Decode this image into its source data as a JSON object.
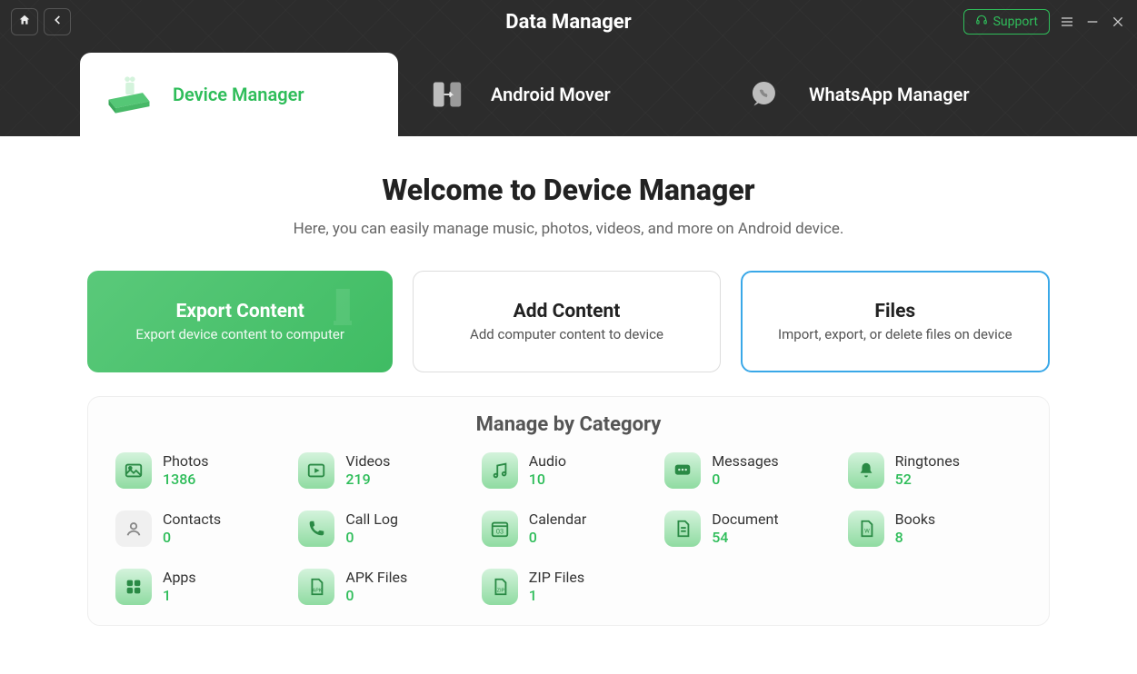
{
  "app": {
    "title": "Data Manager"
  },
  "topbar": {
    "support": "Support"
  },
  "tabs": [
    {
      "label": "Device Manager",
      "active": true
    },
    {
      "label": "Android Mover",
      "active": false
    },
    {
      "label": "WhatsApp Manager",
      "active": false
    }
  ],
  "welcome": {
    "title": "Welcome to Device Manager",
    "subtitle": "Here, you can easily manage music, photos, videos, and more on Android device."
  },
  "cards": {
    "export": {
      "title": "Export Content",
      "subtitle": "Export device content to computer"
    },
    "add": {
      "title": "Add Content",
      "subtitle": "Add computer content to device"
    },
    "files": {
      "title": "Files",
      "subtitle": "Import, export, or delete files on device"
    }
  },
  "category": {
    "title": "Manage by Category",
    "items": [
      {
        "label": "Photos",
        "count": "1386"
      },
      {
        "label": "Videos",
        "count": "219"
      },
      {
        "label": "Audio",
        "count": "10"
      },
      {
        "label": "Messages",
        "count": "0"
      },
      {
        "label": "Ringtones",
        "count": "52"
      },
      {
        "label": "Contacts",
        "count": "0"
      },
      {
        "label": "Call Log",
        "count": "0"
      },
      {
        "label": "Calendar",
        "count": "0"
      },
      {
        "label": "Document",
        "count": "54"
      },
      {
        "label": "Books",
        "count": "8"
      },
      {
        "label": "Apps",
        "count": "1"
      },
      {
        "label": "APK Files",
        "count": "0"
      },
      {
        "label": "ZIP Files",
        "count": "1"
      }
    ]
  }
}
